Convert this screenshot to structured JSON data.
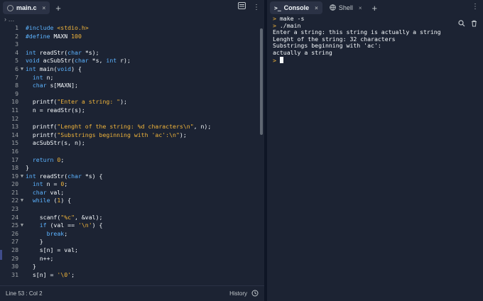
{
  "editor": {
    "tab": {
      "label": "main.c",
      "close": "×"
    },
    "breadcrumb": "…",
    "lines": [
      {
        "n": "1",
        "fold": "",
        "code": "#include <stdio.h>"
      },
      {
        "n": "2",
        "fold": "",
        "code": "#define MAXN 100"
      },
      {
        "n": "3",
        "fold": "",
        "code": ""
      },
      {
        "n": "4",
        "fold": "",
        "code": "int readStr(char *s);"
      },
      {
        "n": "5",
        "fold": "",
        "code": "void acSubStr(char *s, int r);"
      },
      {
        "n": "6",
        "fold": "▼",
        "code": "int main(void) {"
      },
      {
        "n": "7",
        "fold": "",
        "code": "  int n;"
      },
      {
        "n": "8",
        "fold": "",
        "code": "  char s[MAXN];"
      },
      {
        "n": "9",
        "fold": "",
        "code": ""
      },
      {
        "n": "10",
        "fold": "",
        "code": "  printf(\"Enter a string: \");"
      },
      {
        "n": "11",
        "fold": "",
        "code": "  n = readStr(s);"
      },
      {
        "n": "12",
        "fold": "",
        "code": ""
      },
      {
        "n": "13",
        "fold": "",
        "code": "  printf(\"Lenght of the string: %d characters\\n\", n);"
      },
      {
        "n": "14",
        "fold": "",
        "code": "  printf(\"Substrings beginning with 'ac':\\n\");"
      },
      {
        "n": "15",
        "fold": "",
        "code": "  acSubStr(s, n);"
      },
      {
        "n": "16",
        "fold": "",
        "code": ""
      },
      {
        "n": "17",
        "fold": "",
        "code": "  return 0;"
      },
      {
        "n": "18",
        "fold": "",
        "code": "}"
      },
      {
        "n": "19",
        "fold": "▼",
        "code": "int readStr(char *s) {"
      },
      {
        "n": "20",
        "fold": "",
        "code": "  int n = 0;"
      },
      {
        "n": "21",
        "fold": "",
        "code": "  char val;"
      },
      {
        "n": "22",
        "fold": "▼",
        "code": "  while (1) {"
      },
      {
        "n": "23",
        "fold": "",
        "code": ""
      },
      {
        "n": "24",
        "fold": "",
        "code": "    scanf(\"%c\", &val);"
      },
      {
        "n": "25",
        "fold": "▼",
        "code": "    if (val == '\\n') {"
      },
      {
        "n": "26",
        "fold": "",
        "code": "      break;"
      },
      {
        "n": "27",
        "fold": "",
        "code": "    }"
      },
      {
        "n": "28",
        "fold": "",
        "code": "    s[n] = val;"
      },
      {
        "n": "29",
        "fold": "",
        "code": "    n++;"
      },
      {
        "n": "30",
        "fold": "",
        "code": "  }"
      },
      {
        "n": "31",
        "fold": "",
        "code": "  s[n] = '\\0';"
      }
    ]
  },
  "status": {
    "position": "Line 53 : Col 2",
    "history": "History"
  },
  "console": {
    "tabs": [
      {
        "label": "Console",
        "icon": ">_",
        "close": "×"
      },
      {
        "label": "Shell",
        "close": "×"
      }
    ],
    "lines": [
      {
        "prompt": ">",
        "text": " make -s"
      },
      {
        "prompt": ">",
        "text": " ./main"
      },
      {
        "prompt": "",
        "text": "Enter a string: this string is actually a string"
      },
      {
        "prompt": "",
        "text": "Lenght of the string: 32 characters"
      },
      {
        "prompt": "",
        "text": "Substrings beginning with 'ac':"
      },
      {
        "prompt": "",
        "text": "actually a string"
      }
    ],
    "input_prompt": ">"
  },
  "colors": {
    "keyword": "#5cb3ff",
    "string": "#f0b43b",
    "number": "#f0b43b",
    "type": "#5cb3ff",
    "preproc": "#5cb3ff",
    "func": "#f5f9fc"
  }
}
